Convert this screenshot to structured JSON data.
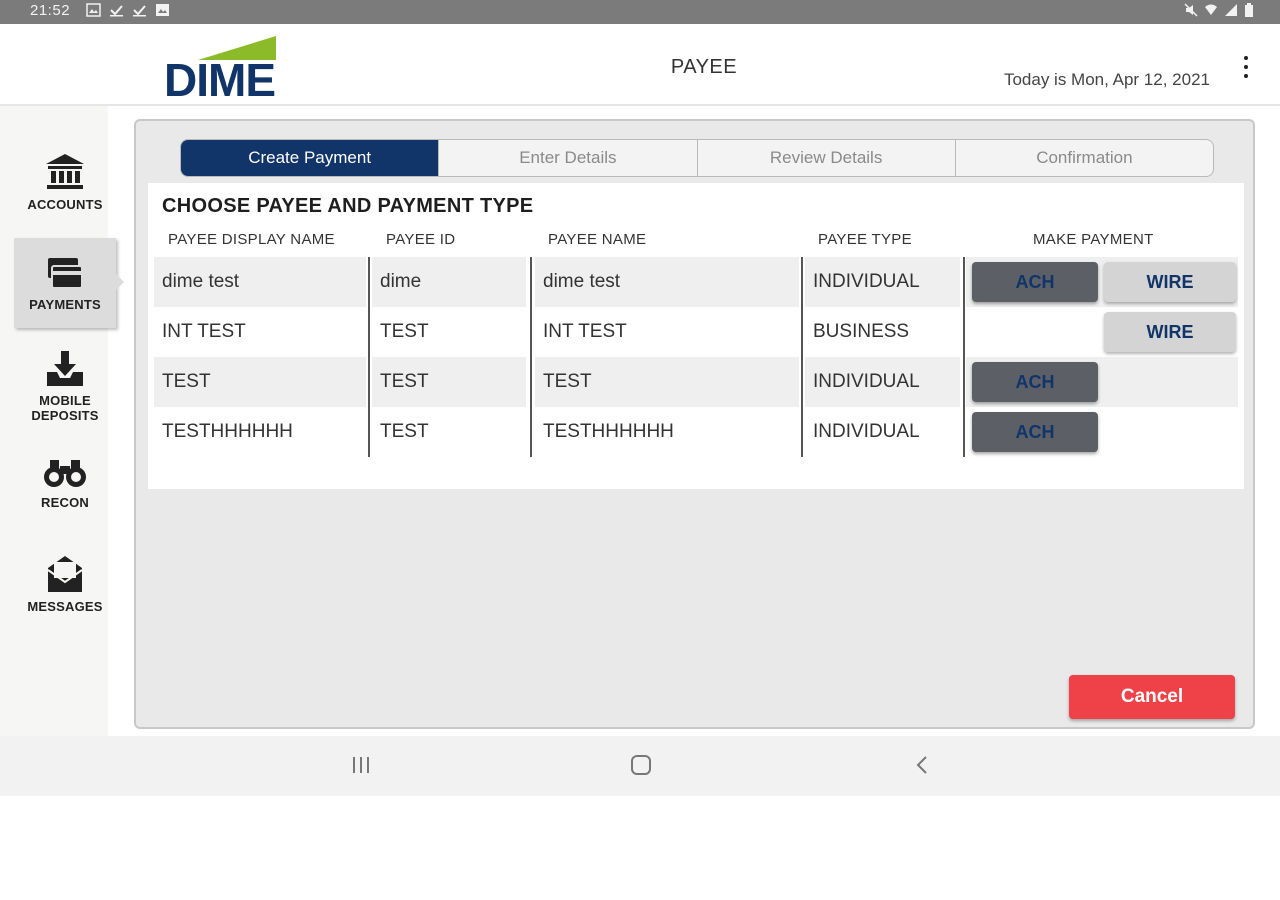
{
  "status_bar": {
    "time": "21:52"
  },
  "header": {
    "logo_text": "DIME",
    "title": "PAYEE",
    "date_text": "Today is Mon, Apr 12, 2021"
  },
  "sidebar": {
    "items": [
      {
        "label": "ACCOUNTS",
        "icon": "bank-icon"
      },
      {
        "label": "PAYMENTS",
        "icon": "credit-card-icon",
        "active": true
      },
      {
        "label_line1": "MOBILE",
        "label_line2": "DEPOSITS",
        "icon": "download-tray-icon"
      },
      {
        "label": "RECON",
        "icon": "binoculars-icon"
      },
      {
        "label": "MESSAGES",
        "icon": "envelope-icon"
      }
    ]
  },
  "stepper": {
    "steps": [
      "Create Payment",
      "Enter Details",
      "Review Details",
      "Confirmation"
    ],
    "active_index": 0
  },
  "payee_table": {
    "title": "CHOOSE PAYEE AND PAYMENT TYPE",
    "columns": [
      "PAYEE DISPLAY NAME",
      "PAYEE ID",
      "PAYEE NAME",
      "PAYEE TYPE",
      "MAKE PAYMENT"
    ],
    "rows": [
      {
        "display_name": "dime test",
        "payee_id": "dime",
        "payee_name": "dime test",
        "payee_type": "INDIVIDUAL",
        "ach": "ACH",
        "wire": "WIRE"
      },
      {
        "display_name": "INT TEST",
        "payee_id": "TEST",
        "payee_name": "INT TEST",
        "payee_type": "BUSINESS",
        "wire": "WIRE"
      },
      {
        "display_name": "TEST",
        "payee_id": "TEST",
        "payee_name": "TEST",
        "payee_type": "INDIVIDUAL",
        "ach": "ACH"
      },
      {
        "display_name": "TESTHHHHHH",
        "payee_id": "TEST",
        "payee_name": "TESTHHHHHH",
        "payee_type": "INDIVIDUAL",
        "ach": "ACH"
      }
    ]
  },
  "actions": {
    "cancel_label": "Cancel"
  },
  "colors": {
    "brand_navy": "#113469",
    "brand_green": "#8cbb2a",
    "cancel_red": "#ee4148"
  }
}
